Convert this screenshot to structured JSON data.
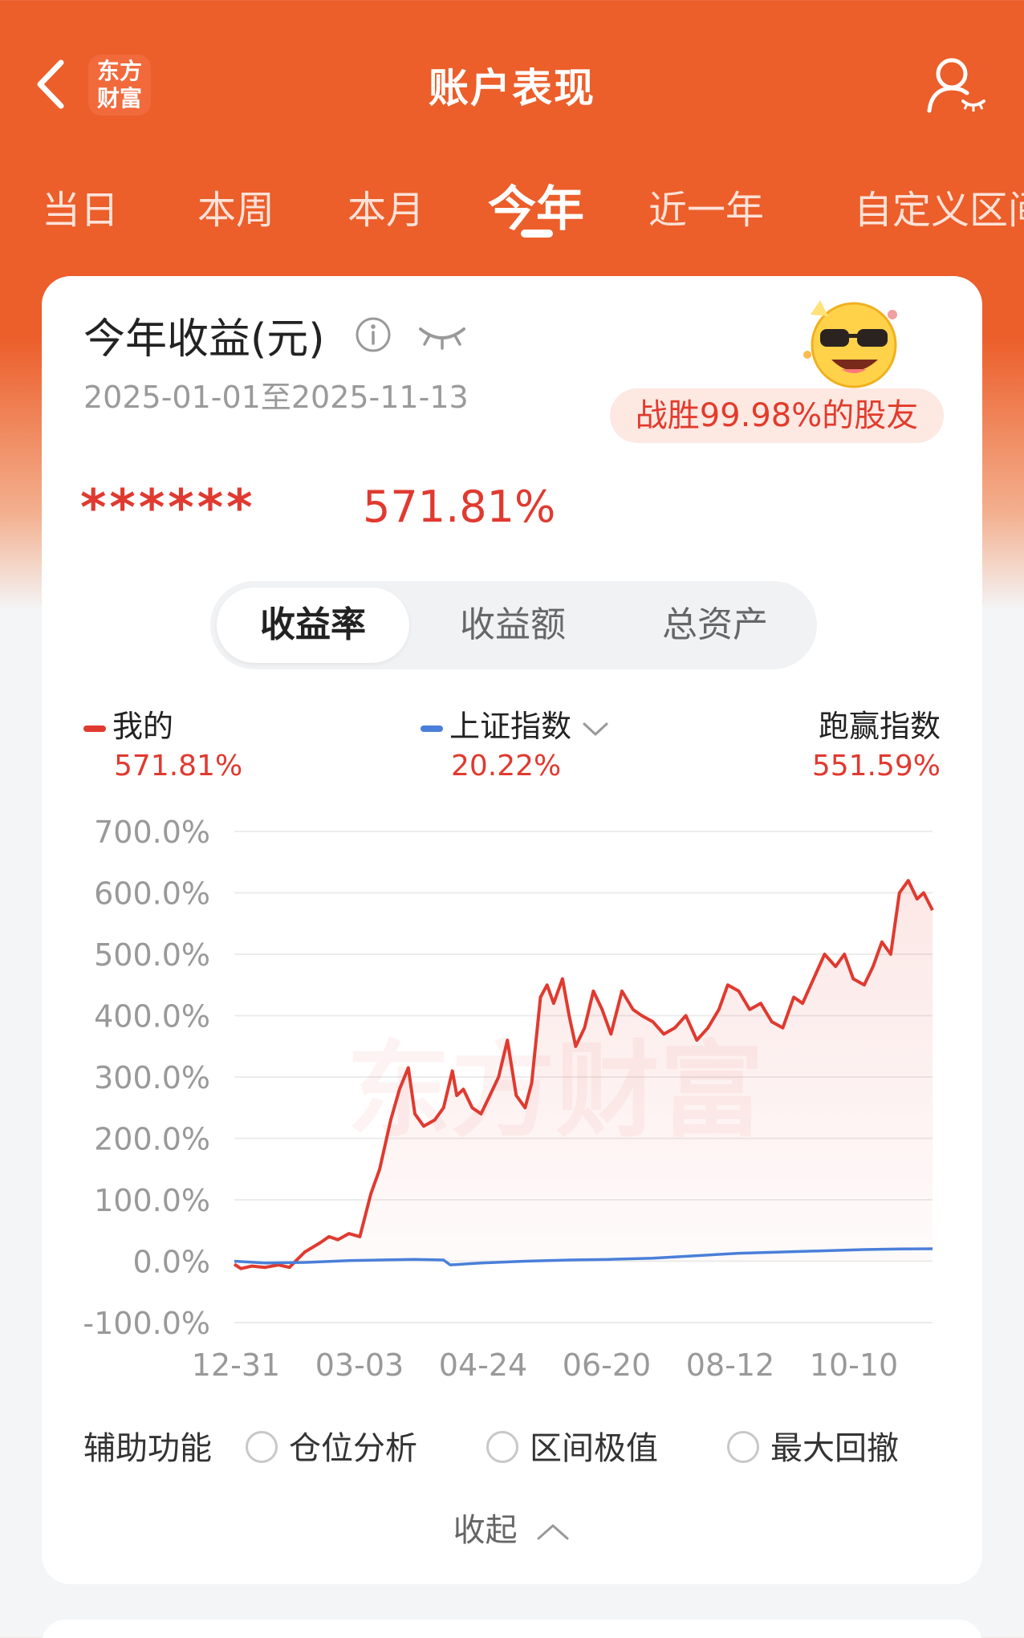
{
  "header": {
    "title": "账户表现",
    "logo_line1": "东方",
    "logo_line2": "财富"
  },
  "tabs": [
    {
      "label": "当日",
      "active": false
    },
    {
      "label": "本周",
      "active": false
    },
    {
      "label": "本月",
      "active": false
    },
    {
      "label": "今年",
      "active": true
    },
    {
      "label": "近一年",
      "active": false
    },
    {
      "label": "自定义区间",
      "active": false
    }
  ],
  "summary": {
    "title": "今年收益(元)",
    "date_range": "2025-01-01至2025-11-13",
    "badge": "战胜99.98%的股友",
    "masked_amount": "******",
    "rate": "571.81%"
  },
  "segment": {
    "options": [
      "收益率",
      "收益额",
      "总资产"
    ],
    "active_index": 0
  },
  "legend": {
    "mine": {
      "label": "我的",
      "value": "571.81%",
      "color": "#e03a30"
    },
    "index": {
      "label": "上证指数",
      "value": "20.22%",
      "color": "#4a7fd9"
    },
    "beat": {
      "label": "跑赢指数",
      "value": "551.59%"
    }
  },
  "watermark": "东方财富",
  "chart_data": {
    "type": "line",
    "ylim": [
      -100,
      700
    ],
    "y_ticks": [
      "700.0%",
      "600.0%",
      "500.0%",
      "400.0%",
      "300.0%",
      "200.0%",
      "100.0%",
      "0.0%",
      "-100.0%"
    ],
    "x_ticks": [
      "12-31",
      "03-03",
      "04-24",
      "06-20",
      "08-12",
      "10-10"
    ],
    "x_range": [
      "2024-12-31",
      "2025-11-13"
    ],
    "grid": true,
    "series": [
      {
        "name": "我的",
        "color": "#e03a30",
        "x": [
          "2024-12-31",
          "2025-01-03",
          "2025-01-08",
          "2025-01-14",
          "2025-01-20",
          "2025-01-25",
          "2025-02-01",
          "2025-02-08",
          "2025-02-12",
          "2025-02-16",
          "2025-02-21",
          "2025-02-26",
          "2025-03-03",
          "2025-03-07",
          "2025-03-12",
          "2025-03-16",
          "2025-03-20",
          "2025-03-23",
          "2025-03-27",
          "2025-04-01",
          "2025-04-05",
          "2025-04-09",
          "2025-04-11",
          "2025-04-14",
          "2025-04-18",
          "2025-04-22",
          "2025-04-26",
          "2025-04-30",
          "2025-05-04",
          "2025-05-08",
          "2025-05-12",
          "2025-05-15",
          "2025-05-19",
          "2025-05-22",
          "2025-05-25",
          "2025-05-29",
          "2025-06-01",
          "2025-06-04",
          "2025-06-08",
          "2025-06-12",
          "2025-06-16",
          "2025-06-20",
          "2025-06-25",
          "2025-06-30",
          "2025-07-04",
          "2025-07-09",
          "2025-07-14",
          "2025-07-19",
          "2025-07-24",
          "2025-07-29",
          "2025-08-03",
          "2025-08-08",
          "2025-08-12",
          "2025-08-17",
          "2025-08-22",
          "2025-08-27",
          "2025-09-01",
          "2025-09-06",
          "2025-09-11",
          "2025-09-15",
          "2025-09-20",
          "2025-09-25",
          "2025-09-30",
          "2025-10-04",
          "2025-10-08",
          "2025-10-13",
          "2025-10-17",
          "2025-10-21",
          "2025-10-25",
          "2025-10-29",
          "2025-11-02",
          "2025-11-06",
          "2025-11-09",
          "2025-11-13"
        ],
        "values": [
          -5,
          -12,
          -8,
          -10,
          -6,
          -10,
          15,
          30,
          40,
          35,
          45,
          40,
          110,
          150,
          230,
          280,
          315,
          240,
          220,
          230,
          250,
          310,
          270,
          280,
          250,
          240,
          270,
          300,
          360,
          270,
          250,
          290,
          430,
          450,
          420,
          460,
          400,
          350,
          380,
          440,
          410,
          370,
          440,
          410,
          400,
          390,
          370,
          380,
          400,
          360,
          380,
          410,
          450,
          440,
          410,
          420,
          390,
          380,
          430,
          420,
          460,
          500,
          480,
          500,
          460,
          450,
          480,
          520,
          500,
          600,
          620,
          590,
          600,
          571.81
        ]
      },
      {
        "name": "上证指数",
        "color": "#4a7fd9",
        "x": [
          "2024-12-31",
          "2025-01-14",
          "2025-02-01",
          "2025-02-21",
          "2025-03-07",
          "2025-03-23",
          "2025-04-05",
          "2025-04-08",
          "2025-04-22",
          "2025-05-12",
          "2025-06-01",
          "2025-06-20",
          "2025-07-09",
          "2025-07-29",
          "2025-08-17",
          "2025-09-06",
          "2025-09-25",
          "2025-10-13",
          "2025-10-29",
          "2025-11-13"
        ],
        "values": [
          0,
          -3,
          -2,
          1,
          2,
          3,
          2,
          -6,
          -3,
          0,
          2,
          3,
          5,
          9,
          13,
          15,
          17,
          19,
          20,
          20.22
        ]
      }
    ]
  },
  "aux": {
    "title": "辅助功能",
    "options": [
      "仓位分析",
      "区间极值",
      "最大回撤"
    ]
  },
  "collapse_label": "收起"
}
